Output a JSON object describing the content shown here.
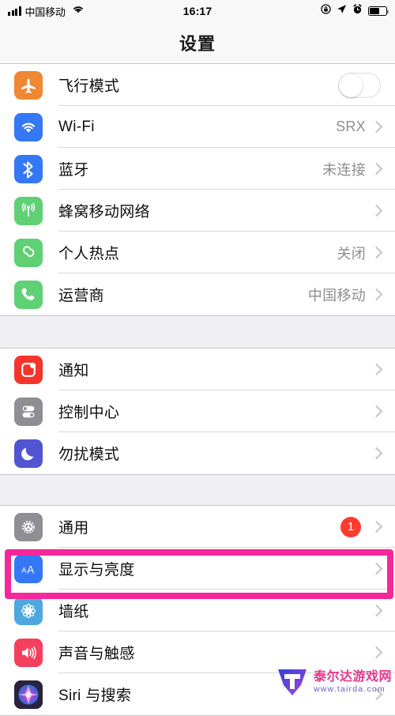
{
  "status_bar": {
    "carrier": "中国移动",
    "signal_icon": "signal-bars-icon",
    "wifi_icon": "wifi-icon",
    "time": "16:17",
    "rotation_lock_icon": "rotation-lock-icon",
    "location_icon": "location-arrow-icon",
    "alarm_icon": "alarm-clock-icon",
    "battery_icon": "battery-icon",
    "battery_level_pct": 62
  },
  "nav": {
    "title": "设置"
  },
  "sections": [
    {
      "id": "connectivity",
      "rows": [
        {
          "id": "airplane-mode",
          "label": "飞行模式",
          "icon": "airplane-icon",
          "icon_color": "#F08733",
          "accessory": "toggle",
          "toggle_on": false,
          "value": ""
        },
        {
          "id": "wifi",
          "label": "Wi-Fi",
          "icon": "wifi-icon",
          "icon_color": "#3478F6",
          "accessory": "chevron",
          "value": "SRX"
        },
        {
          "id": "bluetooth",
          "label": "蓝牙",
          "icon": "bluetooth-icon",
          "icon_color": "#3478F6",
          "accessory": "chevron",
          "value": "未连接"
        },
        {
          "id": "cellular",
          "label": "蜂窝移动网络",
          "icon": "cellular-antenna-icon",
          "icon_color": "#5FD073",
          "accessory": "chevron",
          "value": ""
        },
        {
          "id": "personal-hotspot",
          "label": "个人热点",
          "icon": "hotspot-link-icon",
          "icon_color": "#5FD073",
          "accessory": "chevron",
          "value": "关闭"
        },
        {
          "id": "carrier",
          "label": "运营商",
          "icon": "phone-handset-icon",
          "icon_color": "#5FD073",
          "accessory": "chevron",
          "value": "中国移动"
        }
      ]
    },
    {
      "id": "notifications-group",
      "rows": [
        {
          "id": "notifications",
          "label": "通知",
          "icon": "notification-badge-icon",
          "icon_color": "#F5352B",
          "accessory": "chevron",
          "value": ""
        },
        {
          "id": "control-center",
          "label": "控制中心",
          "icon": "control-center-toggles-icon",
          "icon_color": "#8E8E93",
          "accessory": "chevron",
          "value": ""
        },
        {
          "id": "do-not-disturb",
          "label": "勿扰模式",
          "icon": "crescent-moon-icon",
          "icon_color": "#5255D1",
          "accessory": "chevron",
          "value": ""
        }
      ]
    },
    {
      "id": "general-group",
      "rows": [
        {
          "id": "general",
          "label": "通用",
          "icon": "gear-icon",
          "icon_color": "#8E8E93",
          "accessory": "badge-chevron",
          "badge": "1",
          "value": ""
        },
        {
          "id": "display-brightness",
          "label": "显示与亮度",
          "icon": "aa-text-size-icon",
          "icon_color": "#3478F6",
          "accessory": "chevron",
          "value": "",
          "highlighted": true
        },
        {
          "id": "wallpaper",
          "label": "墙纸",
          "icon": "wallpaper-flower-icon",
          "icon_color": "#4EA8E0",
          "accessory": "chevron",
          "value": ""
        },
        {
          "id": "sounds-haptics",
          "label": "声音与触感",
          "icon": "speaker-volume-icon",
          "icon_color": "#F43F5E",
          "accessory": "chevron",
          "value": ""
        },
        {
          "id": "siri-search",
          "label": "Siri 与搜索",
          "icon": "siri-swirl-icon",
          "icon_color": "#2B2240",
          "accessory": "chevron",
          "value": ""
        }
      ]
    }
  ],
  "highlight": {
    "target_row_id": "display-brightness",
    "color": "#F5279B"
  },
  "watermark": {
    "logo_icon": "tairda-t-logo-icon",
    "site_name": "泰尔达游戏网",
    "url": "www.tairda.com"
  }
}
